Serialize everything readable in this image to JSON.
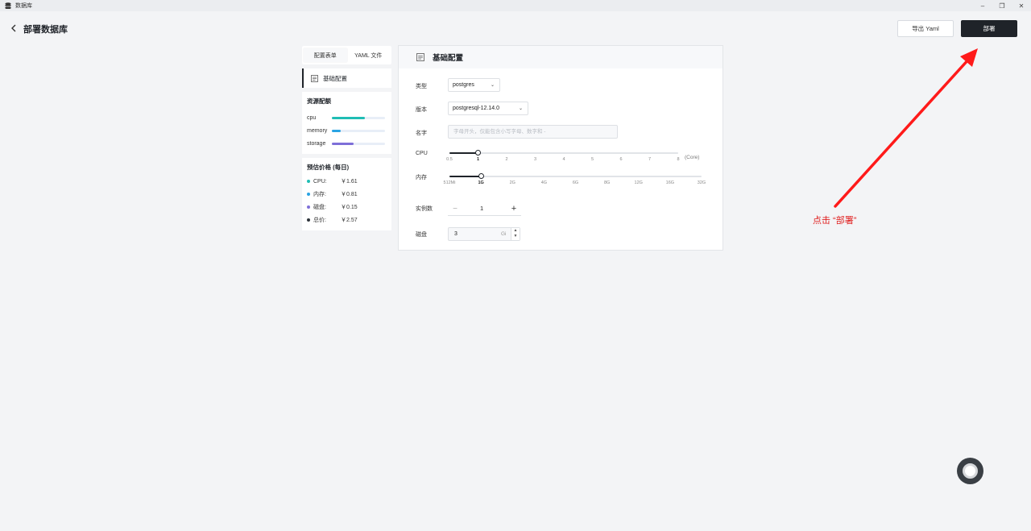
{
  "window": {
    "title": "数据库",
    "icon": "database-icon",
    "controls": [
      "minimize-icon",
      "restore-icon",
      "close-icon"
    ]
  },
  "header": {
    "title": "部署数据库",
    "export_label": "导出 Yaml",
    "deploy_label": "部署"
  },
  "left": {
    "tabs": [
      {
        "label": "配置表单",
        "active": true
      },
      {
        "label": "YAML 文件",
        "active": false
      }
    ],
    "nav_basic": "基础配置",
    "resource_title": "资源配额",
    "resources": [
      {
        "label": "cpu",
        "fill": 0.62,
        "color": "#1fbdb4"
      },
      {
        "label": "memory",
        "fill": 0.16,
        "color": "#2aa3e3"
      },
      {
        "label": "storage",
        "fill": 0.41,
        "color": "#7e6fd8"
      }
    ],
    "price_title": "预估价格 (每日)",
    "prices": [
      {
        "label": "CPU:",
        "value": "￥1.61",
        "color": "#1fbdb4"
      },
      {
        "label": "内存:",
        "value": "￥0.81",
        "color": "#2aa3e3"
      },
      {
        "label": "磁盘:",
        "value": "￥0.15",
        "color": "#7e6fd8"
      },
      {
        "label": "总价:",
        "value": "￥2.57",
        "color": "#2d333a"
      }
    ]
  },
  "form": {
    "title": "基础配置",
    "type_label": "类型",
    "type_value": "postgres",
    "version_label": "版本",
    "version_value": "postgresql-12.14.0",
    "name_label": "名字",
    "name_placeholder": "字母开头，仅能包含小写字母、数字和 -",
    "cpu_label": "CPU",
    "cpu_ticks": [
      "0.5",
      "1",
      "2",
      "3",
      "4",
      "5",
      "6",
      "7",
      "8"
    ],
    "cpu_selected_index": 1,
    "cpu_unit": "(Core)",
    "mem_label": "内存",
    "mem_ticks": [
      "512Mi",
      "1G",
      "2G",
      "4G",
      "6G",
      "8G",
      "12G",
      "16G",
      "32G"
    ],
    "mem_selected_index": 1,
    "replicas_label": "实例数",
    "replicas_value": "1",
    "minus": "−",
    "plus": "+",
    "disk_label": "磁盘",
    "disk_value": "3",
    "disk_unit": "Gi"
  },
  "annotation": {
    "text": "点击 “部署”",
    "color": "#e02020"
  }
}
